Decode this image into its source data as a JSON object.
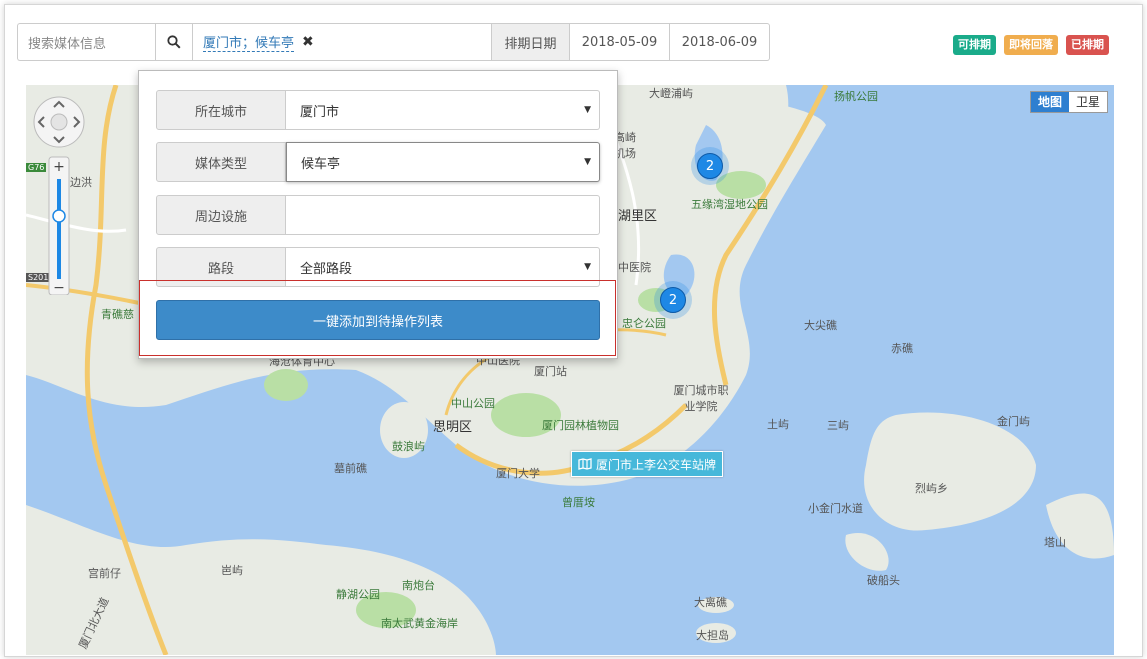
{
  "search": {
    "placeholder": "搜索媒体信息"
  },
  "filter_tag": {
    "text": "厦门市；候车亭"
  },
  "schedule": {
    "label": "排期日期",
    "start": "2018-05-09",
    "end": "2018-06-09"
  },
  "legend": [
    {
      "label": "可排期",
      "color": "#1aab8a"
    },
    {
      "label": "即将回落",
      "color": "#f0ad4e"
    },
    {
      "label": "已排期",
      "color": "#d9534f"
    }
  ],
  "map_type": {
    "map": "地图",
    "satellite": "卫星"
  },
  "panel": {
    "city": {
      "label": "所在城市",
      "value": "厦门市"
    },
    "media_type": {
      "label": "媒体类型",
      "value": "候车亭"
    },
    "nearby": {
      "label": "周边设施",
      "value": ""
    },
    "road": {
      "label": "路段",
      "value": "全部路段"
    },
    "add_button": "一键添加到待操作列表"
  },
  "clusters": [
    {
      "count": "2"
    },
    {
      "count": "2"
    }
  ],
  "station_label": "厦门市上李公交车站牌",
  "map_labels": {
    "l1": "大嶝浦屿",
    "l2": "扬帆公园",
    "l3": "湖里区",
    "l4": "五缘湾湿地公园",
    "l5": "中医院",
    "l6": "忠仑公园",
    "l7": "大尖礁",
    "l8": "赤礁",
    "l9": "厦门城市职业学院",
    "l10": "土屿",
    "l11": "三屿",
    "l12": "金门屿",
    "l13": "烈屿乡",
    "l14": "小金门水道",
    "l15": "塔山",
    "l16": "破船头",
    "l17": "大离礁",
    "l18": "大担岛",
    "l19": "南太武黄金海岸",
    "l20": "南炮台",
    "l21": "静湖公园",
    "l22": "岜屿",
    "l23": "宫前仔",
    "l24": "墓前礁",
    "l25": "鼓浪屿",
    "l26": "思明区",
    "l27": "中山公园",
    "l28": "厦门园林植物园",
    "l29": "厦门大学",
    "l30": "曾厝垵",
    "l31": "厦门站",
    "l32": "青礁慈",
    "l33": "边洪",
    "l34": "海沧体育中心",
    "l35": "中山医院",
    "l36": "高崎机场",
    "l37": "厦门北大道",
    "l38": "G76",
    "l39": "S201"
  }
}
